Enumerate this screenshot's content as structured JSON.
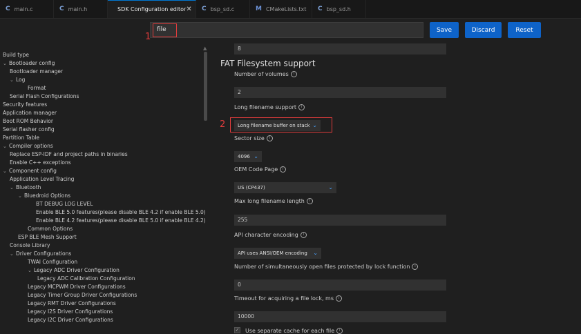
{
  "tabs": [
    {
      "icon": "C",
      "label": "main.c",
      "active": false
    },
    {
      "icon": "C",
      "label": "main.h",
      "active": false
    },
    {
      "icon": "dot",
      "label": "SDK Configuration editor",
      "active": true
    },
    {
      "icon": "C",
      "label": "bsp_sd.c",
      "active": false
    },
    {
      "icon": "M",
      "label": "CMakeLists.txt",
      "active": false
    },
    {
      "icon": "C",
      "label": "bsp_sd.h",
      "active": false
    }
  ],
  "search": {
    "value": "file"
  },
  "annotations": {
    "mark1": "1",
    "mark2": "2"
  },
  "buttons": {
    "save": "Save",
    "discard": "Discard",
    "reset": "Reset"
  },
  "tree": [
    "Build type",
    "Bootloader config",
    "Bootloader manager",
    "Log",
    "Format",
    "Serial Flash Configurations",
    "Security features",
    "Application manager",
    "Boot ROM Behavior",
    "Serial flasher config",
    "Partition Table",
    "Compiler options",
    "Replace ESP-IDF and project paths in binaries",
    "Enable C++ exceptions",
    "Component config",
    "Application Level Tracing",
    "Bluetooth",
    "Bluedroid Options",
    "BT DEBUG LOG LEVEL",
    "Enable BLE 5.0 features(please disable BLE 4.2 if enable BLE 5.0)",
    "Enable BLE 4.2 features(please disable BLE 5.0 if enable BLE 4.2)",
    "Common Options",
    "ESP BLE Mesh Support",
    "Console Library",
    "Driver Configurations",
    "TWAI Configuration",
    "Legacy ADC Driver Configuration",
    "Legacy ADC Calibration Configuration",
    "Legacy MCPWM Driver Configurations",
    "Legacy Timer Group Driver Configurations",
    "Legacy RMT Driver Configurations",
    "Legacy I2S Driver Configurations",
    "Legacy I2C Driver Configurations"
  ],
  "panel": {
    "top_value": "8",
    "section_title": "FAT Filesystem support",
    "num_volumes_label": "Number of volumes",
    "num_volumes_value": "2",
    "lfn_label": "Long filename support",
    "lfn_value": "Long filename buffer on stack",
    "sector_size_label": "Sector size",
    "sector_size_value": "4096",
    "code_page_label": "OEM Code Page",
    "code_page_value": "US (CP437)",
    "max_lfn_label": "Max long filename length",
    "max_lfn_value": "255",
    "api_enc_label": "API character encoding",
    "api_enc_value": "API uses ANSI/OEM encoding",
    "lock_label": "Number of simultaneously open files protected by lock function",
    "lock_value": "0",
    "timeout_label": "Timeout for acquiring a file lock, ms",
    "timeout_value": "10000",
    "cache_label": "Use separate cache for each file"
  }
}
